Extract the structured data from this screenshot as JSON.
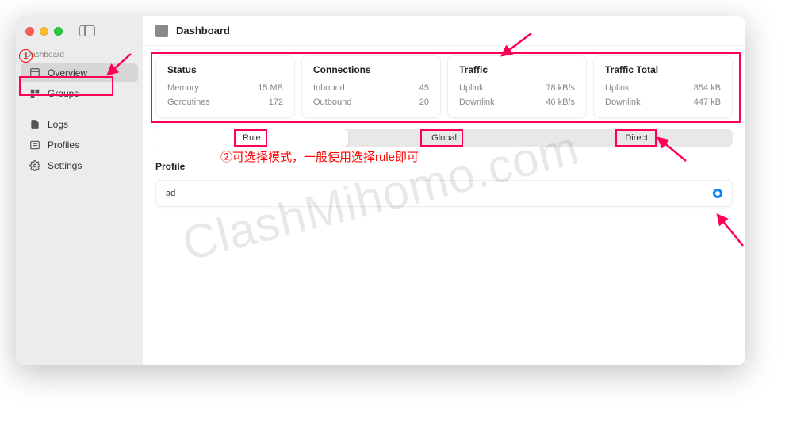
{
  "header": {
    "title": "Dashboard"
  },
  "sidebar": {
    "section1_title": "Dashboard",
    "items1": [
      {
        "label": "Overview"
      },
      {
        "label": "Groups"
      }
    ],
    "items2": [
      {
        "label": "Logs"
      },
      {
        "label": "Profiles"
      },
      {
        "label": "Settings"
      }
    ]
  },
  "stats": [
    {
      "title": "Status",
      "rows": [
        {
          "label": "Memory",
          "value": "15 MB"
        },
        {
          "label": "Goroutines",
          "value": "172"
        }
      ]
    },
    {
      "title": "Connections",
      "rows": [
        {
          "label": "Inbound",
          "value": "45"
        },
        {
          "label": "Outbound",
          "value": "20"
        }
      ]
    },
    {
      "title": "Traffic",
      "rows": [
        {
          "label": "Uplink",
          "value": "78 kB/s"
        },
        {
          "label": "Downlink",
          "value": "46 kB/s"
        }
      ]
    },
    {
      "title": "Traffic Total",
      "rows": [
        {
          "label": "Uplink",
          "value": "854 kB"
        },
        {
          "label": "Downlink",
          "value": "447 kB"
        }
      ]
    }
  ],
  "modes": [
    {
      "label": "Rule",
      "active": true
    },
    {
      "label": "Global",
      "active": false
    },
    {
      "label": "Direct",
      "active": false
    }
  ],
  "profile": {
    "title": "Profile",
    "items": [
      {
        "label": "ad",
        "selected": true
      }
    ]
  },
  "annotations": {
    "num1": "1",
    "num2_text": "②可选择模式，一般使用选择rule即可"
  },
  "watermark": "ClashMihomo.com"
}
